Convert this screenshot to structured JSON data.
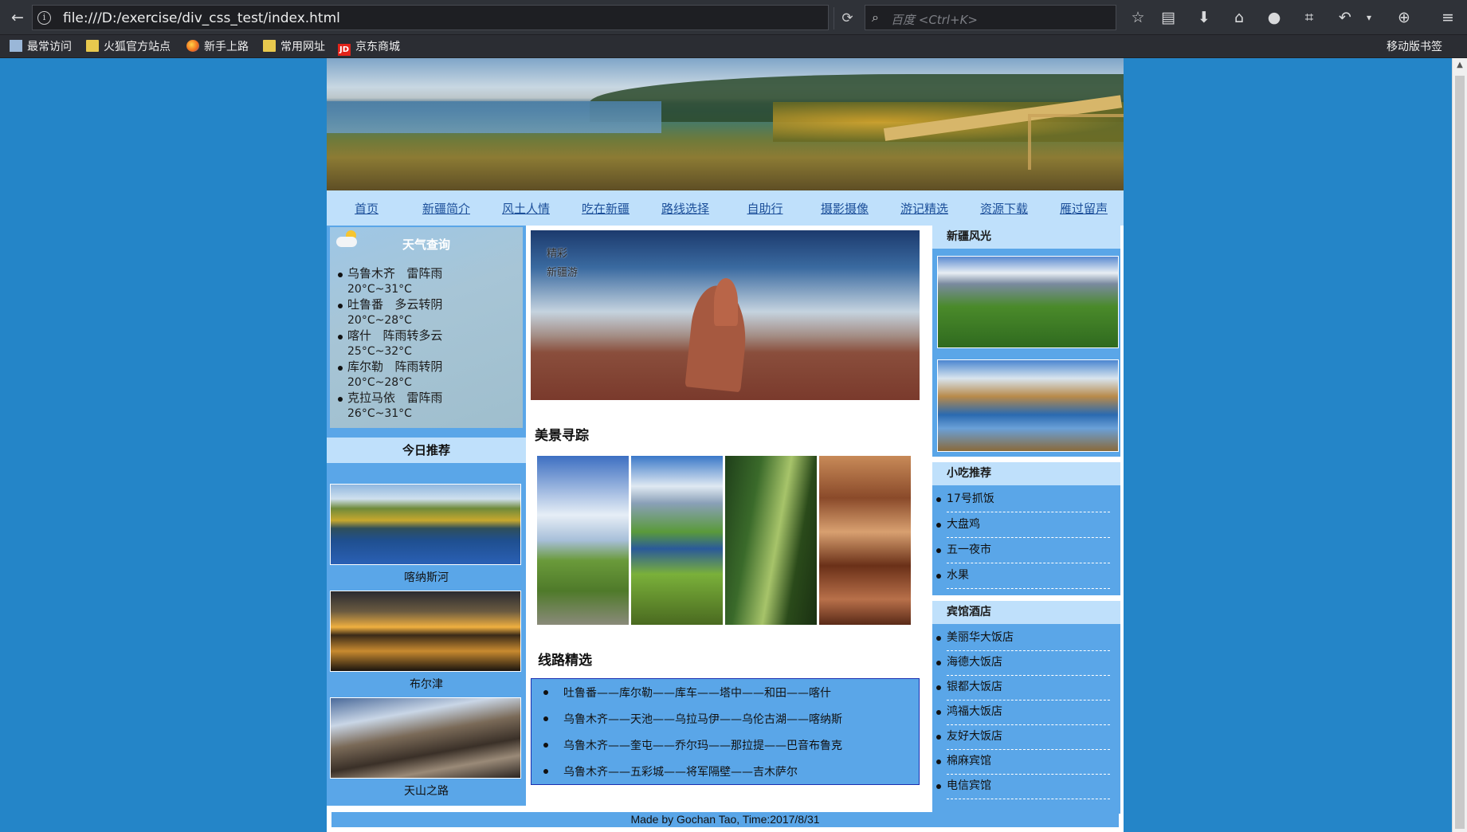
{
  "browser": {
    "url": "file:///D:/exercise/div_css_test/index.html",
    "search_placeholder": "百度 <Ctrl+K>",
    "bookmarks": [
      "最常访问",
      "火狐官方站点",
      "新手上路",
      "常用网址",
      "京东商城"
    ],
    "bookmarks_right": "移动版书签",
    "jd_badge": "JD"
  },
  "nav": [
    "首页",
    "新疆简介",
    "风土人情",
    "吃在新疆",
    "路线选择",
    "自助行",
    "摄影摄像",
    "游记精选",
    "资源下载",
    "雁过留声"
  ],
  "weather": {
    "title": "天气查询",
    "items": [
      {
        "city": "乌鲁木齐",
        "cond": "雷阵雨",
        "temp": "20°C~31°C"
      },
      {
        "city": "吐鲁番",
        "cond": "多云转阴",
        "temp": "20°C~28°C"
      },
      {
        "city": "喀什",
        "cond": "阵雨转多云",
        "temp": "25°C~32°C"
      },
      {
        "city": "库尔勒",
        "cond": "阵雨转阴",
        "temp": "20°C~28°C"
      },
      {
        "city": "克拉马依",
        "cond": "雷阵雨",
        "temp": "26°C~31°C"
      }
    ]
  },
  "today": {
    "title": "今日推荐",
    "items": [
      "喀纳斯河",
      "布尔津",
      "天山之路"
    ]
  },
  "hero_text": [
    "精彩",
    "新疆游"
  ],
  "scenic_title": "美景寻踪",
  "routes_title": "线路精选",
  "routes": [
    "吐鲁番——库尔勒——库车——塔中——和田——喀什",
    "乌鲁木齐——天池——乌拉马伊——乌伦古湖——喀纳斯",
    "乌鲁木齐——奎屯——乔尔玛——那拉提——巴音布鲁克",
    "乌鲁木齐——五彩城——将军隔壁——吉木萨尔"
  ],
  "right": {
    "scenery_title": "新疆风光",
    "snack_title": "小吃推荐",
    "snacks": [
      "17号抓饭",
      "大盘鸡",
      "五一夜市",
      "水果"
    ],
    "hotel_title": "宾馆酒店",
    "hotels": [
      "美丽华大饭店",
      "海德大饭店",
      "银都大饭店",
      "鸿福大饭店",
      "友好大饭店",
      "棉麻宾馆",
      "电信宾馆"
    ]
  },
  "footer": "Made by Gochan Tao, Time:2017/8/31",
  "colors": {
    "page_bg": "#2485c8",
    "panel_blue": "#5aa6e8",
    "light_blue": "#bfe0fb",
    "link": "#1c4f9a"
  }
}
